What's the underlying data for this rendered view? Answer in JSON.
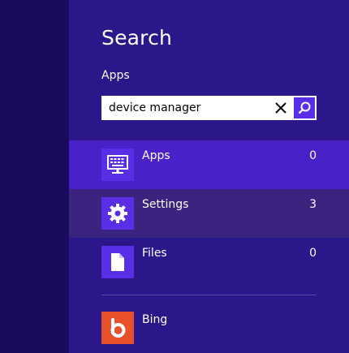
{
  "charm": {
    "title": "Search",
    "scope": "Apps"
  },
  "search": {
    "value": "device manager",
    "clear_icon": "close-icon",
    "submit_icon": "search-icon"
  },
  "categories": [
    {
      "label": "Apps",
      "count": "0",
      "icon": "keyboard-monitor-icon",
      "state": "selected"
    },
    {
      "label": "Settings",
      "count": "3",
      "icon": "gear-icon",
      "state": "hover"
    },
    {
      "label": "Files",
      "count": "0",
      "icon": "document-icon",
      "state": "normal"
    }
  ],
  "providers": [
    {
      "label": "Bing",
      "icon": "bing-logo-icon"
    }
  ],
  "colors": {
    "background": "#1a0b5e",
    "pane": "#2b168a",
    "accent": "#5a2ee6",
    "selected": "#4a20c8",
    "bing": "#e8522a"
  }
}
